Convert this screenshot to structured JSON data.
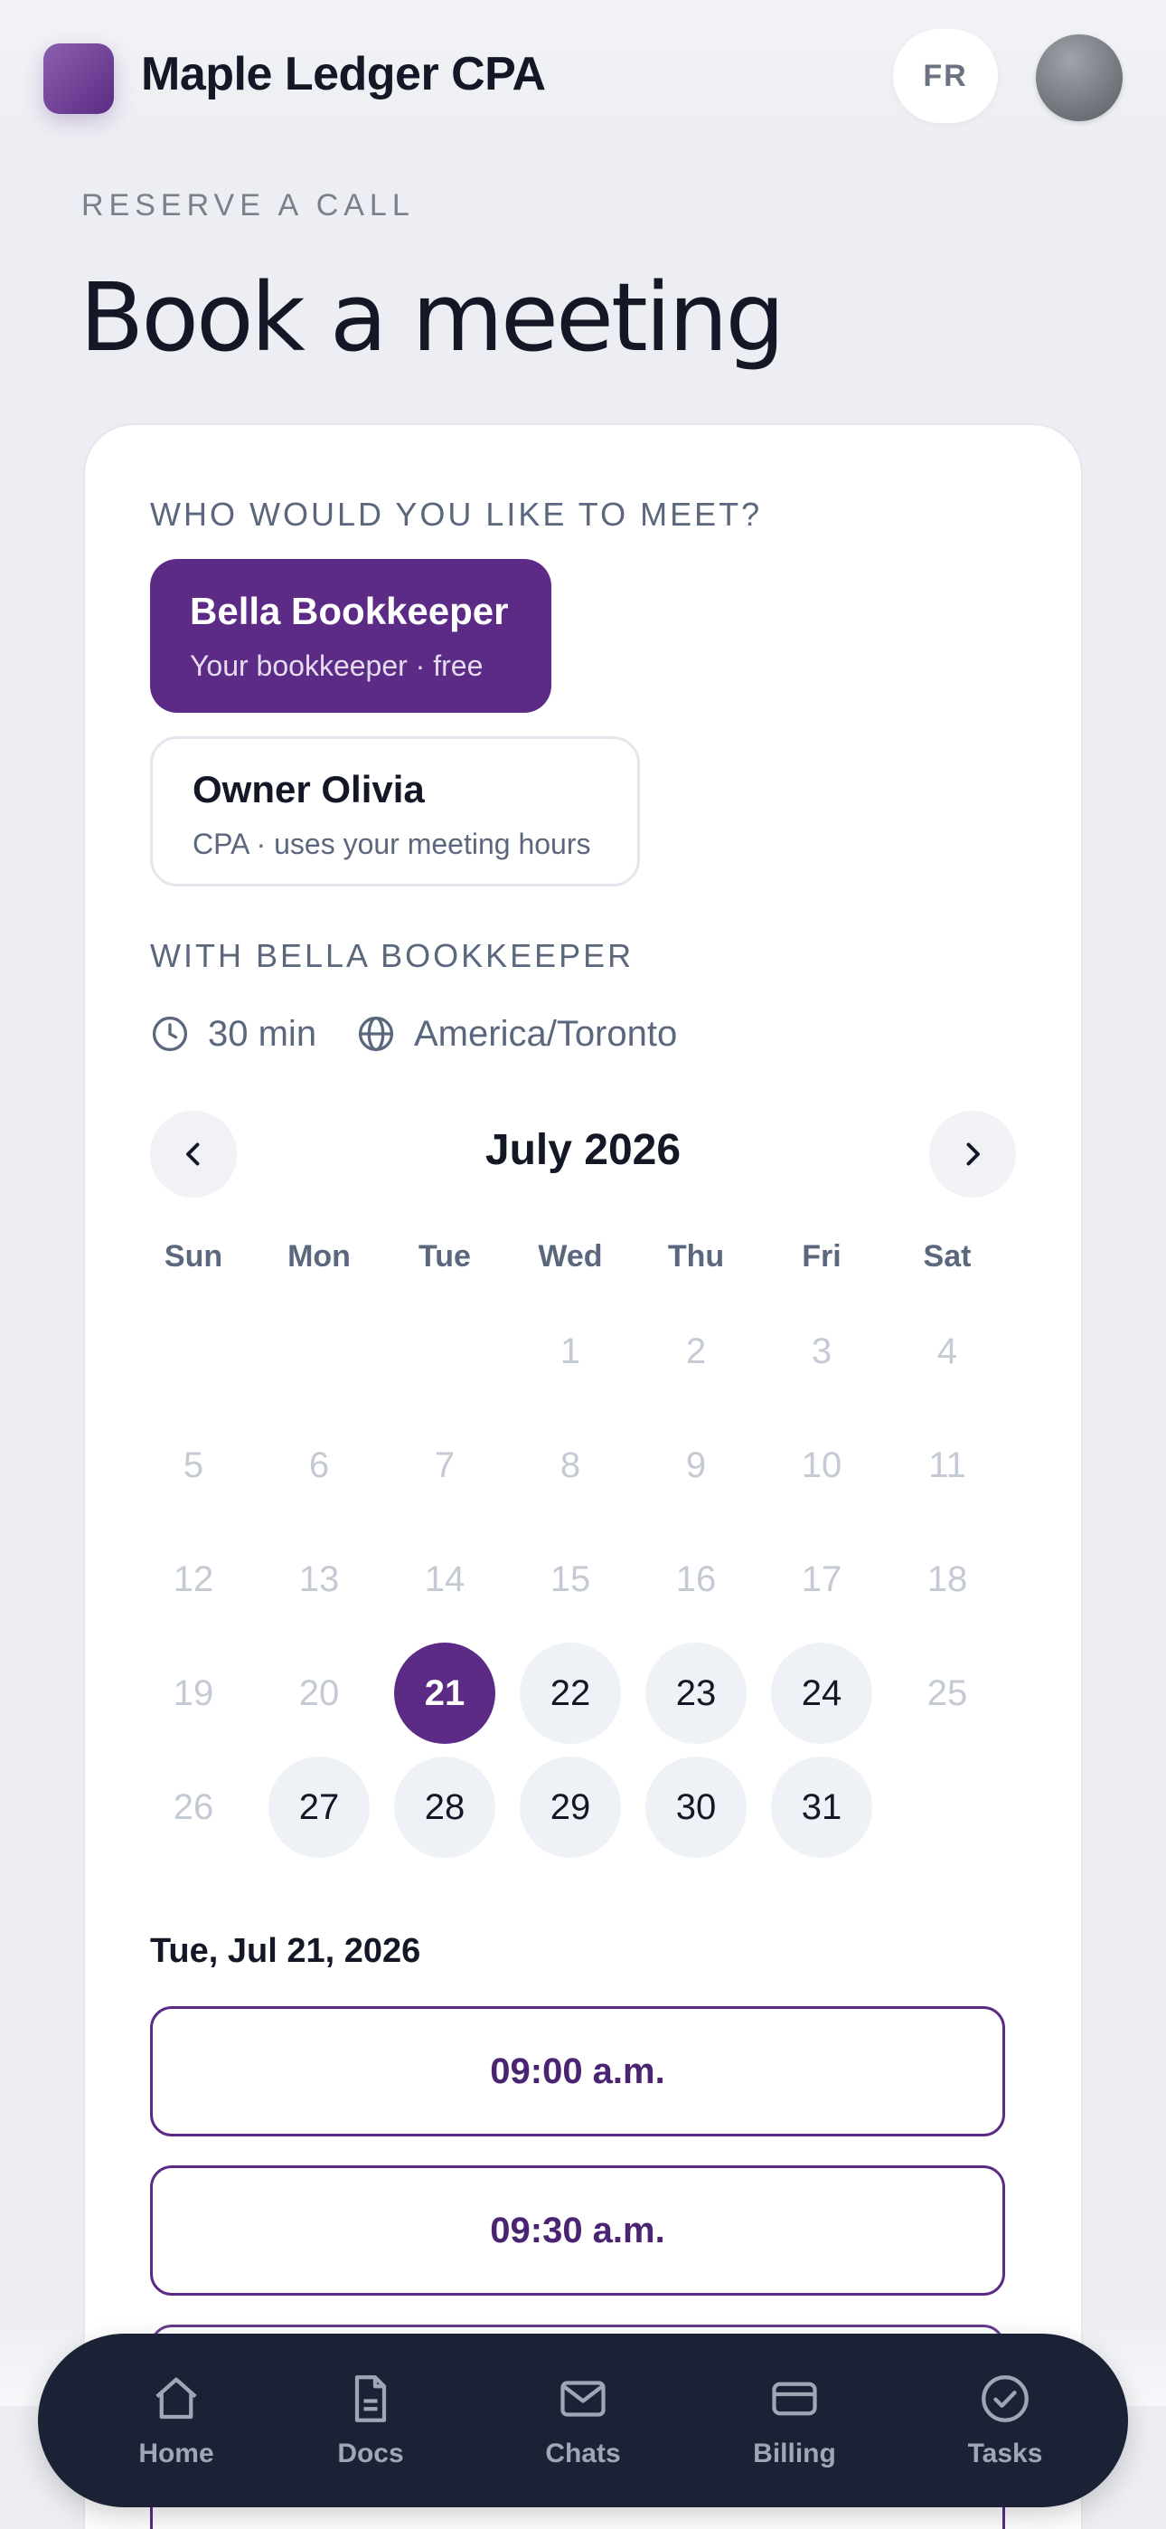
{
  "header": {
    "brand": "Maple Ledger CPA",
    "language_button": "FR"
  },
  "page": {
    "eyebrow": "RESERVE A CALL",
    "title": "Book a meeting"
  },
  "who": {
    "label": "WHO WOULD YOU LIKE TO MEET?",
    "people": [
      {
        "name": "Bella Bookkeeper",
        "desc": "Your bookkeeper · free",
        "selected": true
      },
      {
        "name": "Owner Olivia",
        "desc": "CPA · uses your meeting hours",
        "selected": false
      }
    ]
  },
  "with": {
    "label": "WITH BELLA BOOKKEEPER",
    "duration": "30 min",
    "timezone": "America/Toronto"
  },
  "calendar": {
    "month": "July 2026",
    "weekdays": [
      "Sun",
      "Mon",
      "Tue",
      "Wed",
      "Thu",
      "Fri",
      "Sat"
    ],
    "days": [
      "1",
      "2",
      "3",
      "4",
      "5",
      "6",
      "7",
      "8",
      "9",
      "10",
      "11",
      "12",
      "13",
      "14",
      "15",
      "16",
      "17",
      "18",
      "19",
      "20",
      "21",
      "22",
      "23",
      "24",
      "25",
      "26",
      "27",
      "28",
      "29",
      "30",
      "31"
    ],
    "available_days": [
      "22",
      "23",
      "24",
      "27",
      "28",
      "29",
      "30",
      "31"
    ],
    "selected_day": "21"
  },
  "slots": {
    "date_heading": "Tue, Jul 21, 2026",
    "times": [
      "09:00 a.m.",
      "09:30 a.m."
    ]
  },
  "tabbar": {
    "items": [
      {
        "label": "Home",
        "icon": "home-icon"
      },
      {
        "label": "Docs",
        "icon": "document-icon"
      },
      {
        "label": "Chats",
        "icon": "mail-icon"
      },
      {
        "label": "Billing",
        "icon": "credit-card-icon"
      },
      {
        "label": "Tasks",
        "icon": "check-circle-icon"
      }
    ]
  },
  "colors": {
    "accent": "#5b2b86",
    "nav_bg": "#1c2236",
    "background": "#eceef3"
  }
}
